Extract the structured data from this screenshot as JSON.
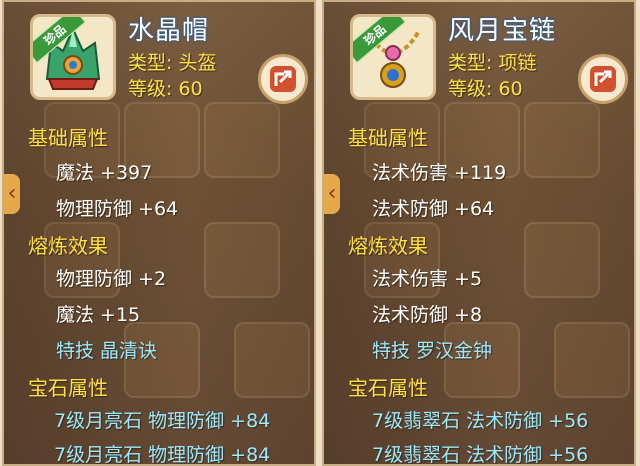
{
  "panels": [
    {
      "badge": "珍品",
      "name": "水晶帽",
      "type_line": "类型: 头盔",
      "level_line": "等级: 60",
      "icon": "crystal-helmet-icon",
      "basic_title": "基础属性",
      "basic": [
        "魔法  +397",
        "物理防御  +64"
      ],
      "refine_title": "熔炼效果",
      "refine": [
        "物理防御  +2",
        "魔法  +15"
      ],
      "skill": "特技  晶清诀",
      "gem_title": "宝石属性",
      "gems": [
        "7级月亮石  物理防御  +84",
        "7级月亮石  物理防御  +84"
      ]
    },
    {
      "badge": "珍品",
      "name": "风月宝链",
      "type_line": "类型: 项链",
      "level_line": "等级: 60",
      "icon": "necklace-icon",
      "basic_title": "基础属性",
      "basic": [
        "法术伤害  +119",
        "法术防御  +64"
      ],
      "refine_title": "熔炼效果",
      "refine": [
        "法术伤害  +5",
        "法术防御  +8"
      ],
      "skill": "特技  罗汉金钟",
      "gem_title": "宝石属性",
      "gems": [
        "7级翡翠石  法术防御  +56",
        "7级翡翠石  法术防御  +56"
      ]
    }
  ],
  "colors": {
    "accent_yellow": "#ffe046",
    "skill_blue": "#9be8ff",
    "name_glow": "#2b6aa8"
  }
}
